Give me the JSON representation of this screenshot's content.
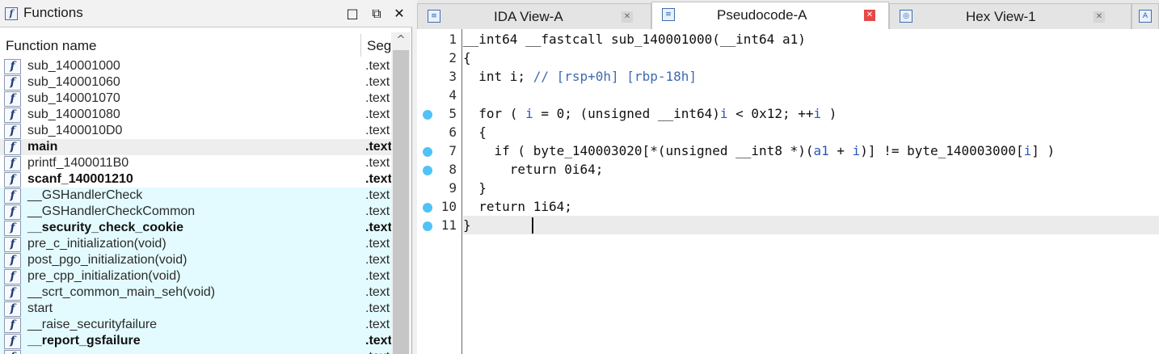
{
  "functions_panel": {
    "title": "Functions",
    "title_icon": "f",
    "window_buttons": [
      "□",
      "⧉",
      "✕"
    ],
    "columns": {
      "name": "Function name",
      "segment": "Segment"
    },
    "rows": [
      {
        "name": "sub_140001000",
        "segment": ".text",
        "library": false,
        "bold": false,
        "selected": false
      },
      {
        "name": "sub_140001060",
        "segment": ".text",
        "library": false,
        "bold": false,
        "selected": false
      },
      {
        "name": "sub_140001070",
        "segment": ".text",
        "library": false,
        "bold": false,
        "selected": false
      },
      {
        "name": "sub_140001080",
        "segment": ".text",
        "library": false,
        "bold": false,
        "selected": false
      },
      {
        "name": "sub_1400010D0",
        "segment": ".text",
        "library": false,
        "bold": false,
        "selected": false
      },
      {
        "name": "main",
        "segment": ".text",
        "library": false,
        "bold": true,
        "selected": true
      },
      {
        "name": "printf_1400011B0",
        "segment": ".text",
        "library": false,
        "bold": false,
        "selected": false
      },
      {
        "name": "scanf_140001210",
        "segment": ".text",
        "library": false,
        "bold": true,
        "selected": false
      },
      {
        "name": "__GSHandlerCheck",
        "segment": ".text",
        "library": true,
        "bold": false,
        "selected": false
      },
      {
        "name": "__GSHandlerCheckCommon",
        "segment": ".text",
        "library": true,
        "bold": false,
        "selected": false
      },
      {
        "name": "__security_check_cookie",
        "segment": ".text",
        "library": true,
        "bold": true,
        "selected": false
      },
      {
        "name": "pre_c_initialization(void)",
        "segment": ".text",
        "library": true,
        "bold": false,
        "selected": false
      },
      {
        "name": "post_pgo_initialization(void)",
        "segment": ".text",
        "library": true,
        "bold": false,
        "selected": false
      },
      {
        "name": "pre_cpp_initialization(void)",
        "segment": ".text",
        "library": true,
        "bold": false,
        "selected": false
      },
      {
        "name": "__scrt_common_main_seh(void)",
        "segment": ".text",
        "library": true,
        "bold": false,
        "selected": false
      },
      {
        "name": "start",
        "segment": ".text",
        "library": true,
        "bold": false,
        "selected": false
      },
      {
        "name": "__raise_securityfailure",
        "segment": ".text",
        "library": true,
        "bold": false,
        "selected": false
      },
      {
        "name": "__report_gsfailure",
        "segment": ".text",
        "library": true,
        "bold": true,
        "selected": false
      },
      {
        "name": "",
        "segment": ".text",
        "library": true,
        "bold": false,
        "selected": false
      }
    ]
  },
  "tabs": [
    {
      "label": "IDA View-A",
      "icon": "list-view-icon",
      "active": false
    },
    {
      "label": "Pseudocode-A",
      "icon": "pseudocode-icon",
      "active": true
    },
    {
      "label": "Hex View-1",
      "icon": "hex-view-icon",
      "active": false
    },
    {
      "label": "",
      "icon": "structures-icon",
      "active": false
    }
  ],
  "pseudocode": {
    "lines": [
      {
        "n": "1",
        "bp": false,
        "tokens": [
          [
            "",
            "__int64 __fastcall sub_140001000(__int64 a1)"
          ]
        ]
      },
      {
        "n": "2",
        "bp": false,
        "tokens": [
          [
            "",
            "{"
          ]
        ]
      },
      {
        "n": "3",
        "bp": false,
        "tokens": [
          [
            "",
            "  int i; "
          ],
          [
            "cmt",
            "// [rsp+0h] [rbp-18h]"
          ]
        ]
      },
      {
        "n": "4",
        "bp": false,
        "tokens": []
      },
      {
        "n": "5",
        "bp": true,
        "tokens": [
          [
            "",
            "  for ( "
          ],
          [
            "var",
            "i"
          ],
          [
            "",
            " = 0; (unsigned __int64)"
          ],
          [
            "var",
            "i"
          ],
          [
            "",
            " < 0x12; ++"
          ],
          [
            "var",
            "i"
          ],
          [
            "",
            " )"
          ]
        ]
      },
      {
        "n": "6",
        "bp": false,
        "tokens": [
          [
            "",
            "  {"
          ]
        ]
      },
      {
        "n": "7",
        "bp": true,
        "tokens": [
          [
            "",
            "    if ( byte_140003020[*(unsigned __int8 *)("
          ],
          [
            "var",
            "a1"
          ],
          [
            "",
            " + "
          ],
          [
            "var",
            "i"
          ],
          [
            "",
            ")] != byte_140003000["
          ],
          [
            "var",
            "i"
          ],
          [
            "",
            "] )"
          ]
        ]
      },
      {
        "n": "8",
        "bp": true,
        "tokens": [
          [
            "",
            "      return 0i64;"
          ]
        ]
      },
      {
        "n": "9",
        "bp": false,
        "tokens": [
          [
            "",
            "  }"
          ]
        ]
      },
      {
        "n": "10",
        "bp": true,
        "tokens": [
          [
            "",
            "  return 1i64;"
          ]
        ]
      },
      {
        "n": "11",
        "bp": true,
        "tokens": [
          [
            "",
            "}"
          ]
        ]
      }
    ],
    "current_line": "11"
  },
  "colors": {
    "library_row": "#e3fbff",
    "breakpoint": "#4fc3f7",
    "comment": "#3f6ab1",
    "variable": "#2d56b8",
    "active_close": "#e64848"
  }
}
